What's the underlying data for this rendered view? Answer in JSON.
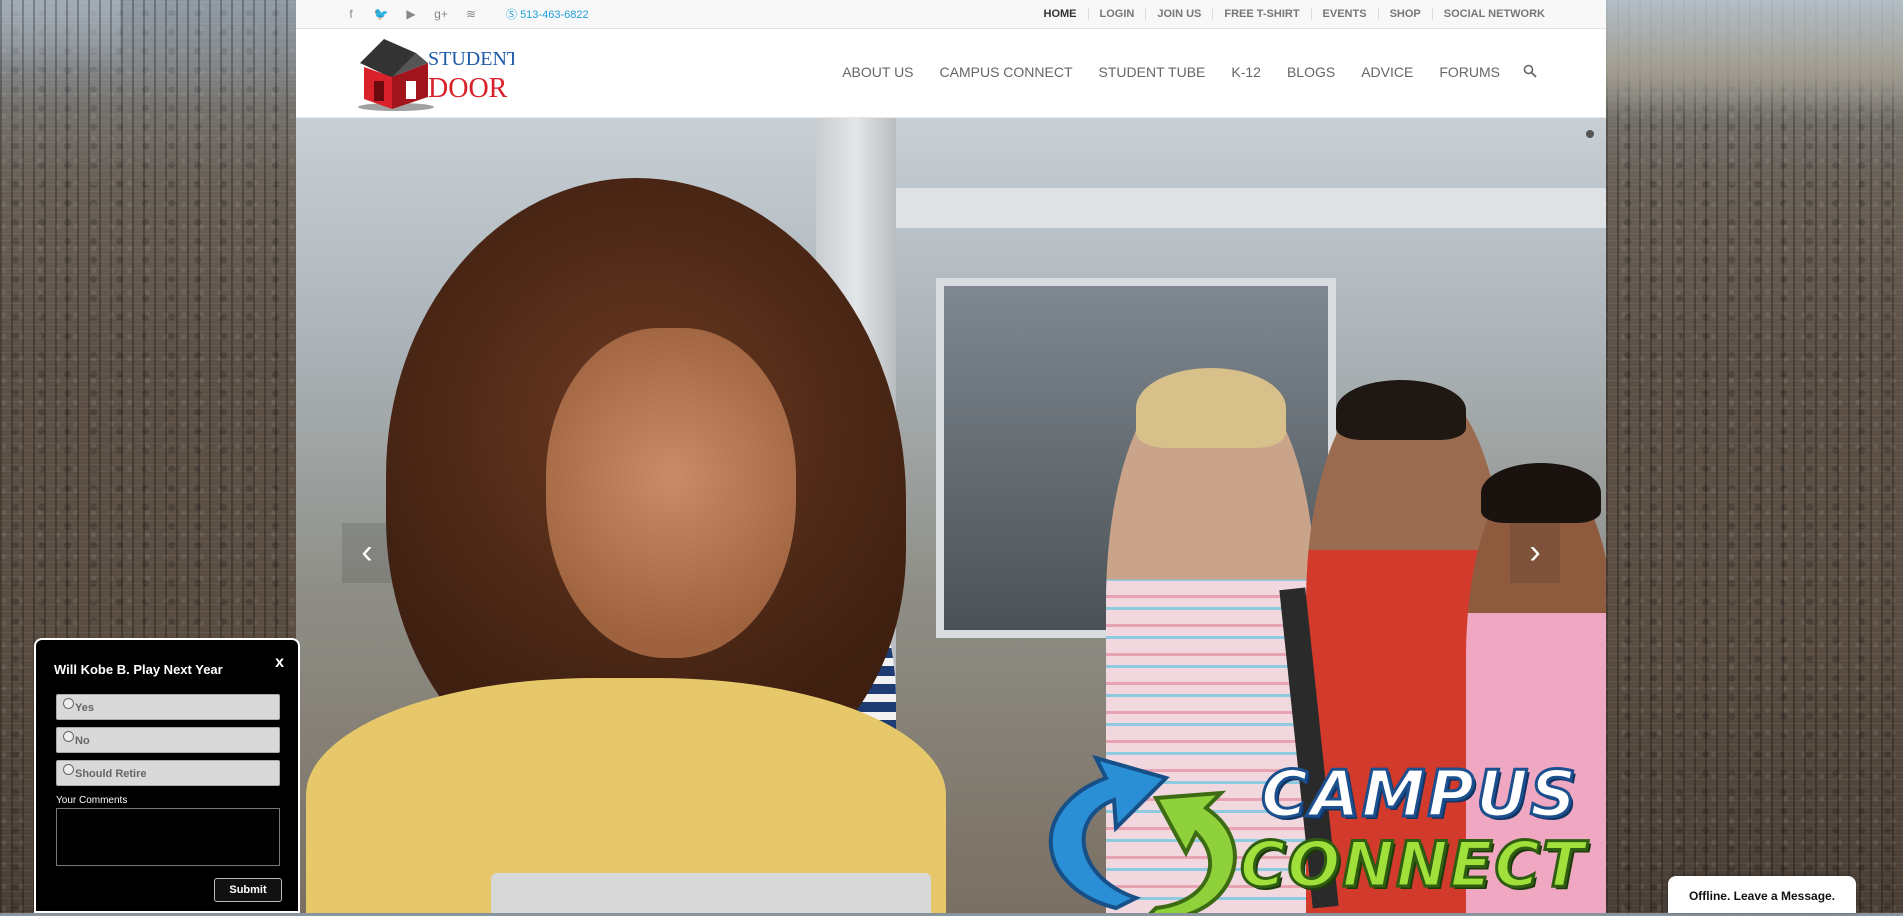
{
  "topbar": {
    "social_icons": [
      "facebook-icon",
      "twitter-icon",
      "youtube-icon",
      "google-plus-icon",
      "rss-icon"
    ],
    "phone": "513-463-6822",
    "nav": [
      "HOME",
      "LOGIN",
      "JOIN US",
      "FREE T-SHIRT",
      "EVENTS",
      "SHOP",
      "SOCIAL NETWORK"
    ]
  },
  "logo": {
    "line1": "STUDENT",
    "line2": "DOOR"
  },
  "main_nav": [
    "ABOUT US",
    "CAMPUS CONNECT",
    "STUDENT TUBE",
    "K-12",
    "BLOGS",
    "ADVICE",
    "FORUMS"
  ],
  "hero": {
    "brand_line1": "CAMPUS",
    "brand_line2": "CONNECT",
    "prev_arrow": "‹",
    "next_arrow": "›"
  },
  "poll": {
    "title": "Will Kobe B. Play Next Year",
    "close": "x",
    "options": [
      "Yes",
      "No",
      "Should Retire"
    ],
    "comments_label": "Your Comments",
    "submit": "Submit"
  },
  "chat": {
    "label": "Offline. Leave a Message."
  },
  "colors": {
    "accent": "#1f9ed9",
    "logo_red": "#d8212a",
    "campus_green": "#9fe03a"
  }
}
